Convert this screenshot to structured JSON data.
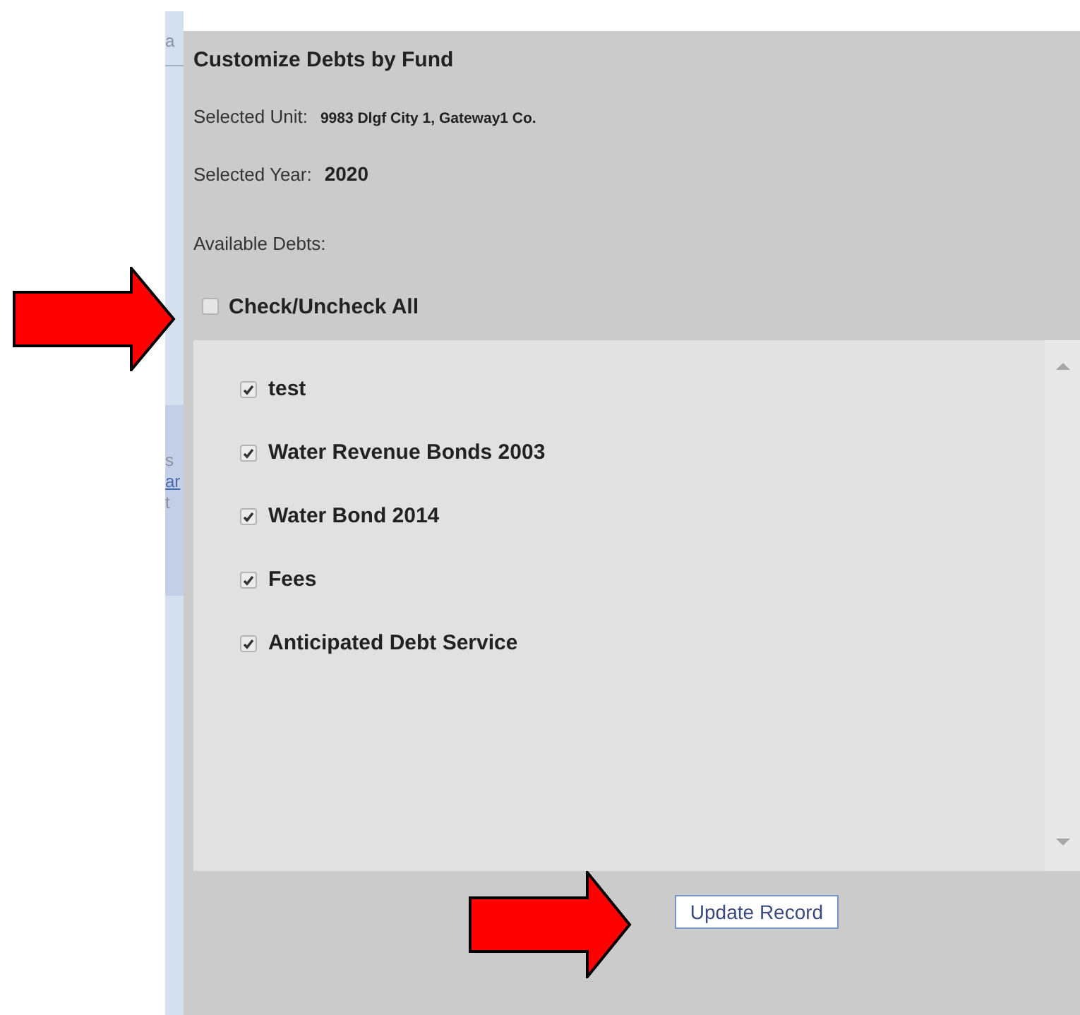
{
  "background_fragments": [
    {
      "text": "a",
      "kind": "plain"
    },
    {
      "text": "s",
      "kind": "plain"
    },
    {
      "text": "ar",
      "kind": "link"
    },
    {
      "text": "t",
      "kind": "plain"
    }
  ],
  "dialog": {
    "title": "Customize Debts by Fund",
    "fields": [
      {
        "label": "Selected Unit:",
        "value": "9983 Dlgf City 1, Gateway1 Co.",
        "kind": "small"
      },
      {
        "label": "Selected Year:",
        "value": "2020",
        "kind": "large"
      }
    ],
    "list_label": "Available Debts:",
    "check_all": {
      "label": "Check/Uncheck All",
      "checked": false
    },
    "debts": [
      {
        "label": "test",
        "checked": true
      },
      {
        "label": "Water Revenue Bonds 2003",
        "checked": true
      },
      {
        "label": "Water Bond 2014",
        "checked": true
      },
      {
        "label": "Fees",
        "checked": true
      },
      {
        "label": "Anticipated Debt Service",
        "checked": true
      }
    ],
    "button": "Update Record"
  }
}
